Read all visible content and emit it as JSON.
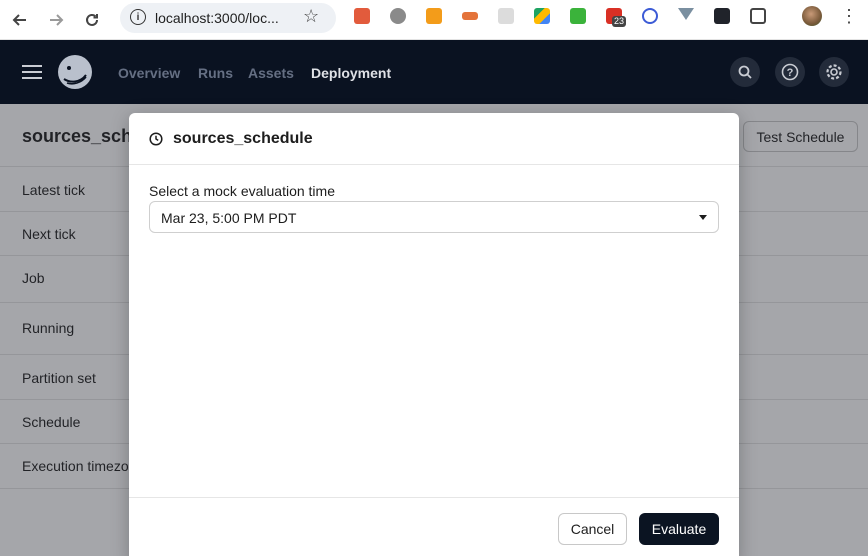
{
  "browser": {
    "url": "localhost:3000/loc...",
    "extension_badge": "23",
    "back_icon": "arrow-left-icon",
    "forward_icon": "arrow-right-icon",
    "reload_icon": "reload-icon",
    "info_icon": "info-icon",
    "bookmark_icon": "star-icon",
    "menu_icon": "kebab-menu-icon"
  },
  "header": {
    "nav": [
      {
        "label": "Overview"
      },
      {
        "label": "Runs"
      },
      {
        "label": "Assets"
      },
      {
        "label": "Deployment"
      }
    ],
    "active_nav": "Deployment",
    "search_icon": "search-icon",
    "help_icon": "help-icon",
    "settings_icon": "gear-icon",
    "bg_color": "#0a1221"
  },
  "page": {
    "title": "sources_sche",
    "test_button": "Test Schedule",
    "rows": [
      {
        "label": "Latest tick"
      },
      {
        "label": "Next tick"
      },
      {
        "label": "Job"
      },
      {
        "label": "Running"
      },
      {
        "label": "Partition set"
      },
      {
        "label": "Schedule"
      },
      {
        "label": "Execution timezo"
      }
    ]
  },
  "modal": {
    "title": "sources_schedule",
    "title_icon": "clock-icon",
    "field_label": "Select a mock evaluation time",
    "selected_time": "Mar 23, 5:00 PM PDT",
    "cancel_label": "Cancel",
    "evaluate_label": "Evaluate",
    "primary_color": "#0b1422"
  }
}
